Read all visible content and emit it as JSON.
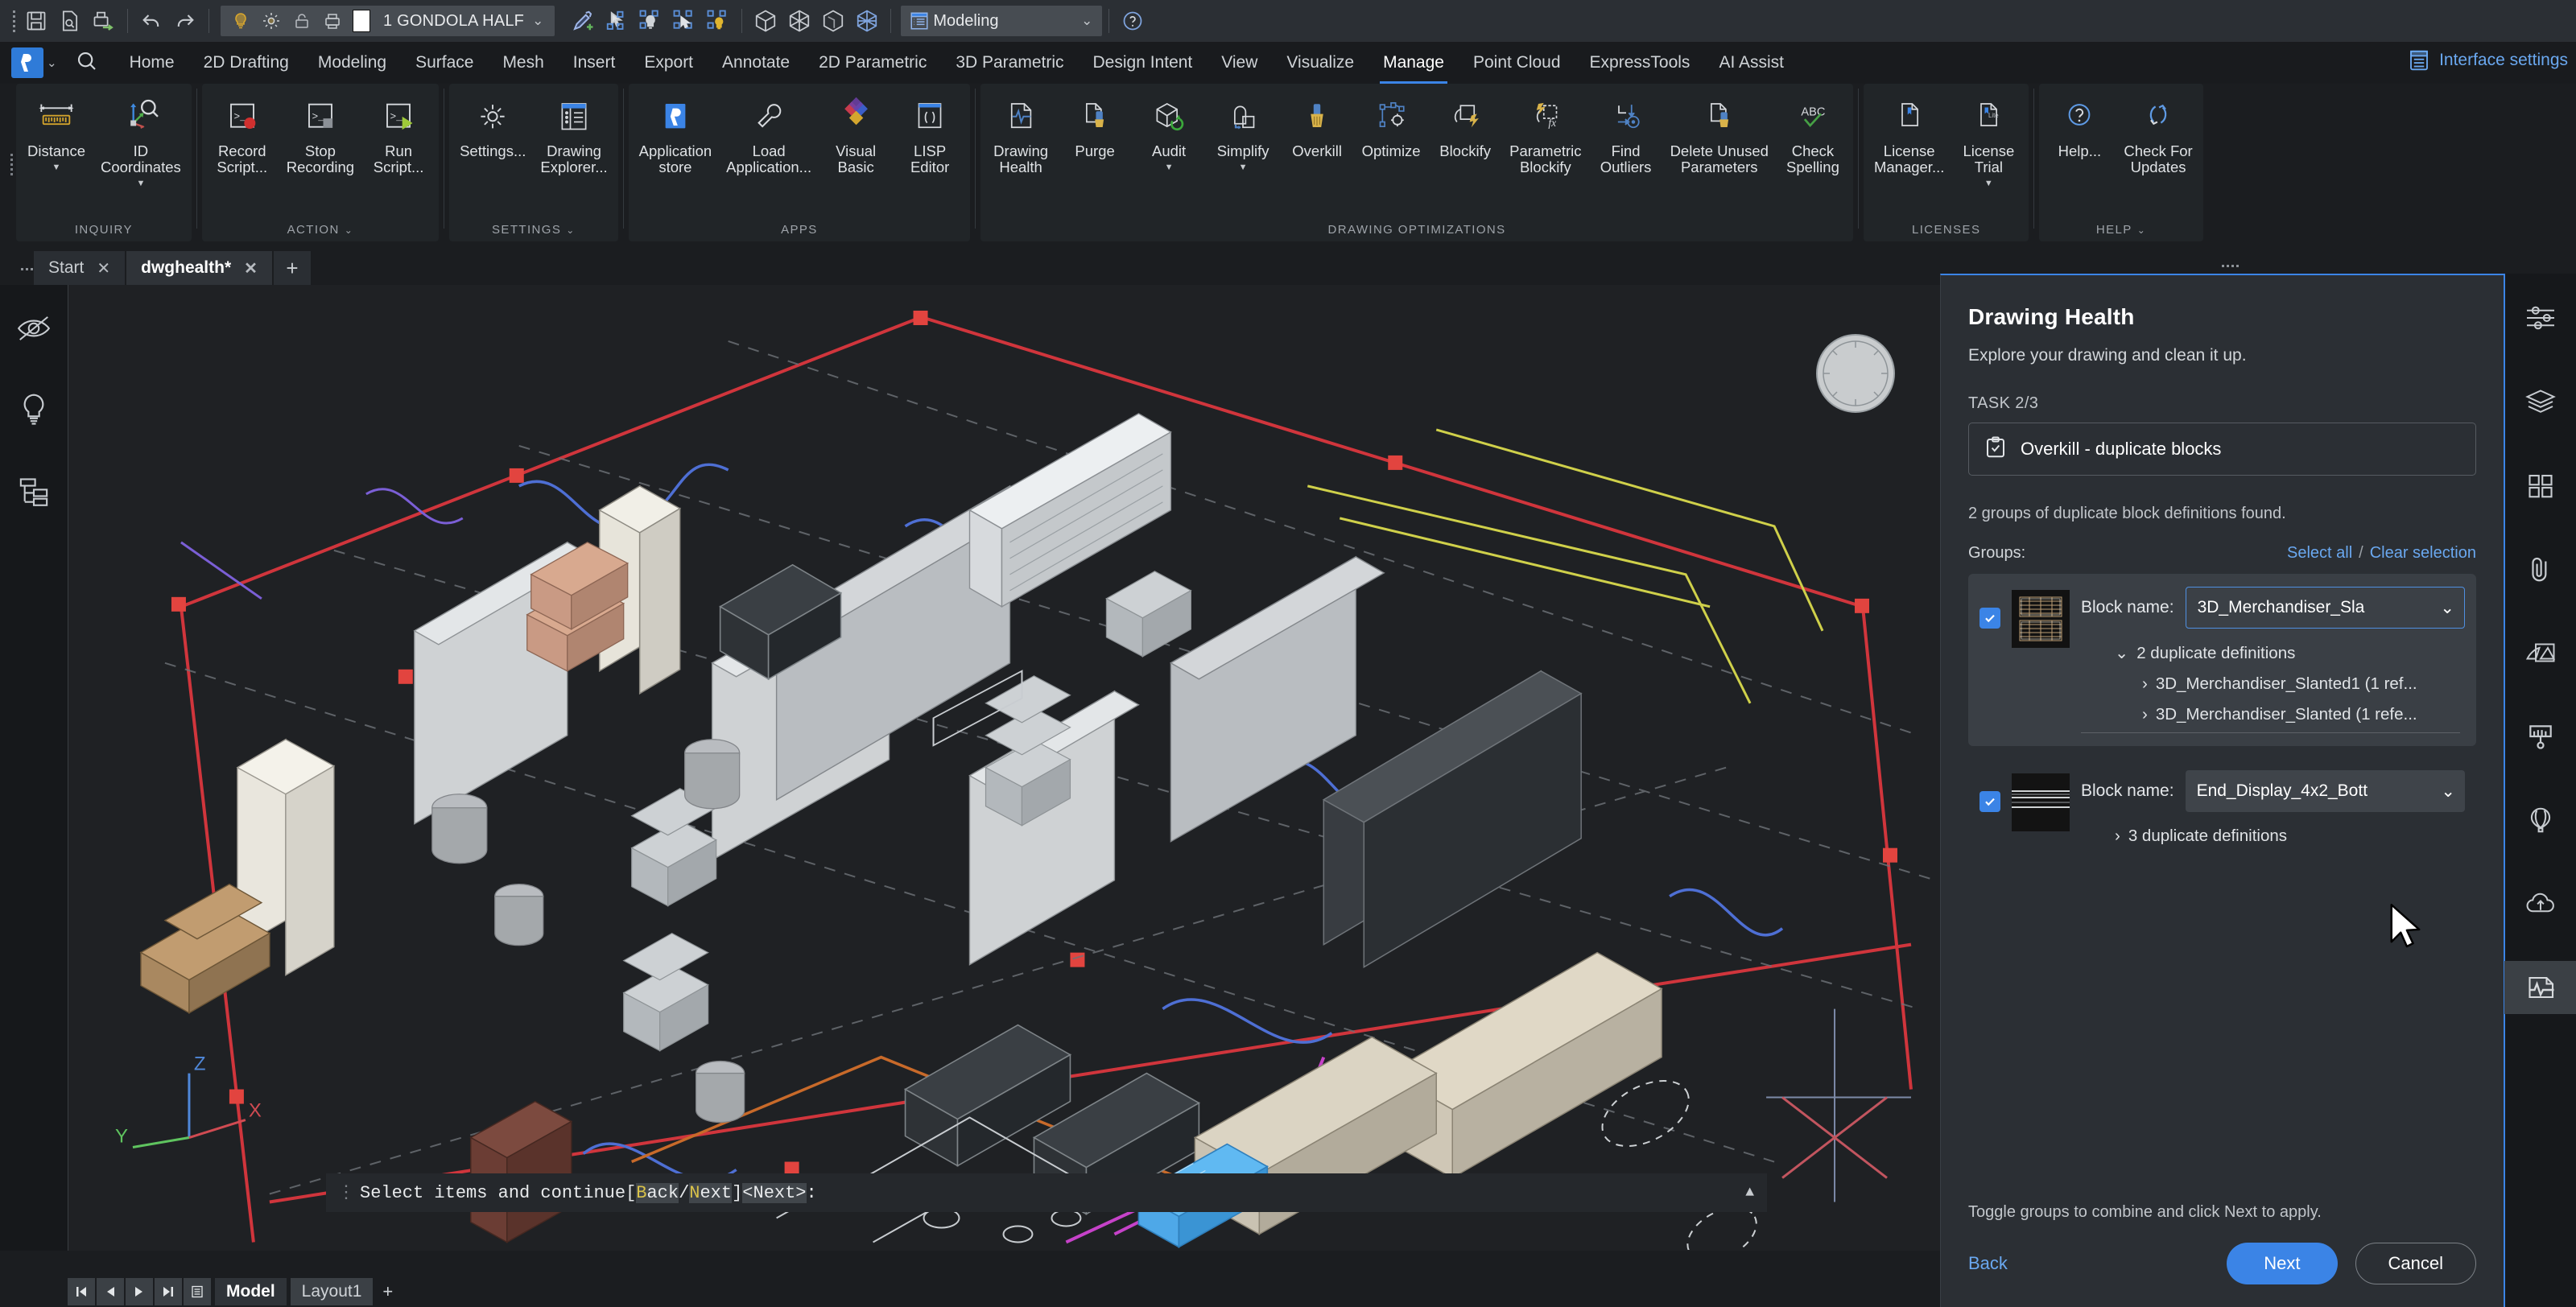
{
  "quick_access": {
    "icons": [
      "save-icon",
      "print-preview-icon",
      "plot-icon",
      "undo-icon",
      "redo-icon",
      "layer-on-icon",
      "layer-freeze-icon",
      "layer-lock-icon",
      "layer-plot-icon"
    ],
    "layer_name": "1 GONDOLA HALF",
    "layer_color": "#ffffff",
    "right_icons": [
      "match-properties-icon",
      "select-similar-icon",
      "select-by-layer-icon",
      "quick-select-icon",
      "isolate-layer-icon",
      "solid-icon",
      "surface-icon",
      "shell-icon",
      "mesh-icon",
      "workspace-icon"
    ],
    "workspace": "Modeling",
    "help_icon": "help-icon"
  },
  "ribbon_tabs": {
    "brand": "bricscad-logo",
    "items": [
      "Home",
      "2D Drafting",
      "Modeling",
      "Surface",
      "Mesh",
      "Insert",
      "Export",
      "Annotate",
      "2D Parametric",
      "3D Parametric",
      "Design Intent",
      "View",
      "Visualize",
      "Manage",
      "Point Cloud",
      "ExpressTools",
      "AI Assist"
    ],
    "active": "Manage",
    "interface_settings": "Interface settings"
  },
  "ribbon_panels": [
    {
      "title": "INQUIRY",
      "has_caret": false,
      "commands": [
        {
          "label": "Distance",
          "icon": "distance-icon",
          "dropdown": true
        },
        {
          "label": "ID\nCoordinates",
          "icon": "id-coordinates-icon",
          "dropdown": true
        }
      ]
    },
    {
      "title": "ACTION",
      "has_caret": true,
      "commands": [
        {
          "label": "Record\nScript...",
          "icon": "record-script-icon",
          "dropdown": false
        },
        {
          "label": "Stop\nRecording",
          "icon": "stop-recording-icon",
          "dropdown": false
        },
        {
          "label": "Run\nScript...",
          "icon": "run-script-icon",
          "dropdown": false
        }
      ]
    },
    {
      "title": "SETTINGS",
      "has_caret": true,
      "commands": [
        {
          "label": "Settings...",
          "icon": "gear-icon",
          "dropdown": false
        },
        {
          "label": "Drawing\nExplorer...",
          "icon": "drawing-explorer-icon",
          "dropdown": false
        }
      ]
    },
    {
      "title": "APPS",
      "has_caret": false,
      "commands": [
        {
          "label": "Application\nstore",
          "icon": "application-store-icon",
          "dropdown": false
        },
        {
          "label": "Load\nApplication...",
          "icon": "wrench-icon",
          "dropdown": false
        },
        {
          "label": "Visual\nBasic",
          "icon": "visual-basic-icon",
          "dropdown": false
        },
        {
          "label": "LISP\nEditor",
          "icon": "lisp-editor-icon",
          "dropdown": false
        }
      ]
    },
    {
      "title": "DRAWING OPTIMIZATIONS",
      "has_caret": false,
      "commands": [
        {
          "label": "Drawing\nHealth",
          "icon": "drawing-health-icon",
          "dropdown": false
        },
        {
          "label": "Purge",
          "icon": "purge-icon",
          "dropdown": false
        },
        {
          "label": "Audit",
          "icon": "audit-icon",
          "dropdown": true
        },
        {
          "label": "Simplify",
          "icon": "simplify-icon",
          "dropdown": true
        },
        {
          "label": "Overkill",
          "icon": "overkill-icon",
          "dropdown": false
        },
        {
          "label": "Optimize",
          "icon": "optimize-icon",
          "dropdown": false
        },
        {
          "label": "Blockify",
          "icon": "blockify-icon",
          "dropdown": false
        },
        {
          "label": "Parametric\nBlockify",
          "icon": "parametric-blockify-icon",
          "dropdown": false
        },
        {
          "label": "Find\nOutliers",
          "icon": "find-outliers-icon",
          "dropdown": false
        },
        {
          "label": "Delete Unused\nParameters",
          "icon": "delete-unused-parameters-icon",
          "dropdown": false
        },
        {
          "label": "Check\nSpelling",
          "icon": "check-spelling-icon",
          "dropdown": false
        }
      ]
    },
    {
      "title": "LICENSES",
      "has_caret": false,
      "commands": [
        {
          "label": "License\nManager...",
          "icon": "license-manager-icon",
          "dropdown": false
        },
        {
          "label": "License\nTrial",
          "icon": "license-trial-icon",
          "dropdown": true
        }
      ]
    },
    {
      "title": "HELP",
      "has_caret": true,
      "commands": [
        {
          "label": "Help...",
          "icon": "help-circle-icon",
          "dropdown": false
        },
        {
          "label": "Check For\nUpdates",
          "icon": "check-for-updates-icon",
          "dropdown": false
        }
      ]
    }
  ],
  "document_tabs": {
    "tabs": [
      {
        "label": "Start",
        "active": false
      },
      {
        "label": "dwghealth*",
        "active": true
      }
    ],
    "new_tab": "+"
  },
  "left_rail": [
    "hide-entity-icon",
    "light-bulb-icon",
    "structure-tree-icon"
  ],
  "right_rail": {
    "items": [
      "properties-icon",
      "layers-icon",
      "blocks-icon",
      "attachments-icon",
      "render-icon",
      "brush-icon",
      "balloon-icon",
      "cloud-upload-icon",
      "drawing-health-icon"
    ],
    "active": "drawing-health-icon"
  },
  "command_line": {
    "prefix": "Select items and continue ",
    "bracket_open": "[",
    "kw1_head": "B",
    "kw1_tail": "ack",
    "slash": "/",
    "kw2_head": "N",
    "kw2_tail": "ext",
    "bracket_close": "] ",
    "default": "<Next>",
    "colon": ":"
  },
  "status_bar": {
    "nav": [
      "first-icon",
      "prev-icon",
      "next-icon",
      "last-icon",
      "layout-list-icon"
    ],
    "tabs": [
      {
        "label": "Model",
        "active": true
      },
      {
        "label": "Layout1",
        "active": false
      }
    ],
    "add": "+"
  },
  "drawing_health": {
    "title": "Drawing Health",
    "subtitle": "Explore your drawing and clean it up.",
    "task_label": "TASK 2/3",
    "task_name": "Overkill - duplicate blocks",
    "task_icon": "clipboard-check-icon",
    "found_text": "2 groups of duplicate block definitions found.",
    "groups_label": "Groups:",
    "select_all": "Select all",
    "separator": "/",
    "clear_selection": "Clear selection",
    "groups": [
      {
        "checked": true,
        "selected": true,
        "thumbnail": "merchandiser-slanted-thumb",
        "block_name_label": "Block name:",
        "block_name_value": "3D_Merchandiser_Sla",
        "combo_focused": true,
        "duplicates_label": "2 duplicate definitions",
        "expanded": true,
        "children": [
          "3D_Merchandiser_Slanted1 (1 ref...",
          "3D_Merchandiser_Slanted (1 refe..."
        ]
      },
      {
        "checked": true,
        "selected": false,
        "thumbnail": "end-display-thumb",
        "block_name_label": "Block name:",
        "block_name_value": "End_Display_4x2_Bott",
        "combo_focused": false,
        "duplicates_label": "3 duplicate definitions",
        "expanded": false,
        "children": []
      }
    ],
    "hint": "Toggle groups to combine and click Next to apply.",
    "back": "Back",
    "next": "Next",
    "cancel": "Cancel",
    "accent_color": "#3b84e6"
  }
}
